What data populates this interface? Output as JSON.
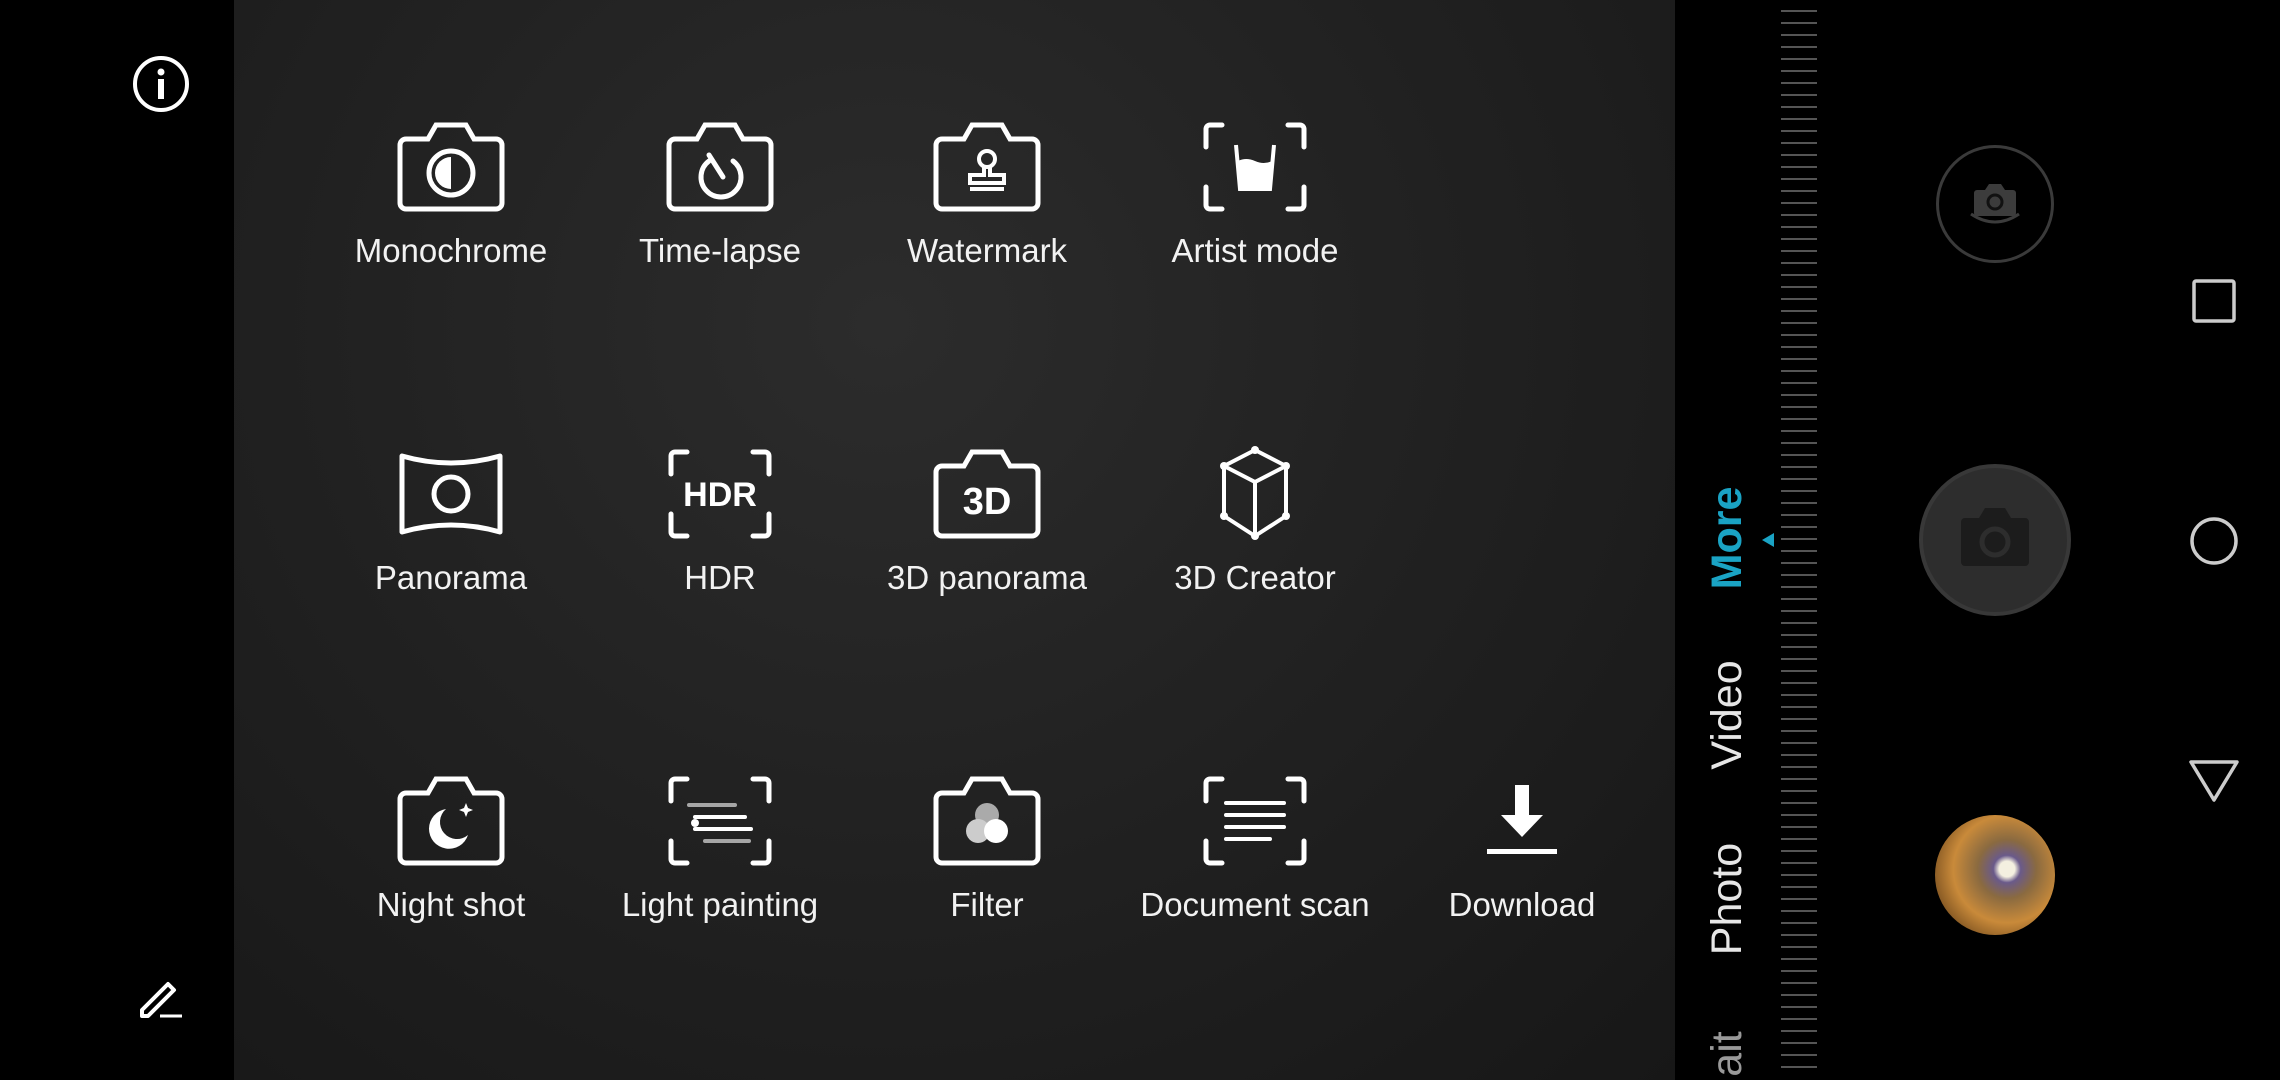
{
  "left_bar": {
    "info_icon": "info-icon",
    "edit_icon": "edit-pencil-icon"
  },
  "modes": [
    {
      "label": "Monochrome",
      "icon": "monochrome-camera-icon"
    },
    {
      "label": "Time-lapse",
      "icon": "time-lapse-camera-icon"
    },
    {
      "label": "Watermark",
      "icon": "watermark-stamp-icon"
    },
    {
      "label": "Artist mode",
      "icon": "artist-glass-icon"
    },
    {
      "label": "Panorama",
      "icon": "panorama-icon"
    },
    {
      "label": "HDR",
      "icon": "hdr-icon"
    },
    {
      "label": "3D panorama",
      "icon": "3d-panorama-icon"
    },
    {
      "label": "3D Creator",
      "icon": "cube-icon"
    },
    {
      "label": "Night shot",
      "icon": "night-shot-icon"
    },
    {
      "label": "Light painting",
      "icon": "light-painting-icon"
    },
    {
      "label": "Filter",
      "icon": "filter-icon"
    },
    {
      "label": "Document scan",
      "icon": "document-scan-icon"
    },
    {
      "label": "Download",
      "icon": "download-icon"
    }
  ],
  "hdr_text": "HDR",
  "d3_text": "3D",
  "mode_tabs": [
    {
      "label": "More",
      "active": true
    },
    {
      "label": "Video",
      "active": false
    },
    {
      "label": "Photo",
      "active": false
    },
    {
      "label": "ait",
      "active": false
    }
  ],
  "colors": {
    "accent": "#1aa3c4",
    "panel": "#252525",
    "icon": "#ffffff"
  },
  "controls": {
    "switch_camera": "switch-camera-icon",
    "shutter": "shutter-icon",
    "gallery": "gallery-thumbnail"
  },
  "nav": {
    "recents": "square-icon",
    "home": "circle-icon",
    "back": "triangle-icon"
  }
}
